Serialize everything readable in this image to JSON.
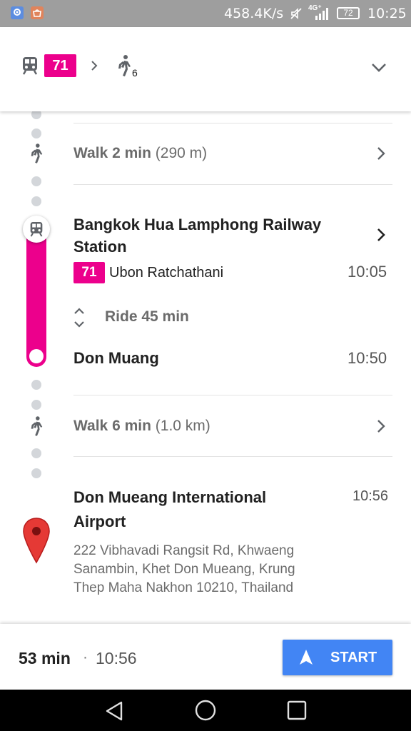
{
  "status_bar": {
    "speed": "458.4K/s",
    "network": "4G⁺",
    "battery": "72",
    "time": "10:25"
  },
  "header": {
    "route_number": "71",
    "walk_count": "6"
  },
  "steps": {
    "walk1": {
      "duration": "Walk 2 min",
      "distance": "(290 m)"
    },
    "departure": {
      "station_line1": "Bangkok Hua Lamphong Railway",
      "station_line2": "Station",
      "route_number": "71",
      "headsign": "Ubon Ratchathani",
      "time": "10:05",
      "ride": "Ride 45 min"
    },
    "arrival": {
      "station": "Don Muang",
      "time": "10:50"
    },
    "walk2": {
      "duration": "Walk 6 min",
      "distance": "(1.0 km)"
    },
    "destination": {
      "name_line1": "Don Mueang International",
      "name_line2": "Airport",
      "time": "10:56",
      "address_line1": "222 Vibhavadi Rangsit Rd, Khwaeng",
      "address_line2": "Sanambin, Khet Don Mueang, Krung",
      "address_line3": "Thep Maha Nakhon 10210, Thailand"
    }
  },
  "bottom_bar": {
    "total_duration": "53 min",
    "separator": "·",
    "arrival_time": "10:56",
    "start_label": "START"
  },
  "colors": {
    "transit_line": "#ec008c",
    "start_button": "#4285f4",
    "pin": "#e53935"
  }
}
